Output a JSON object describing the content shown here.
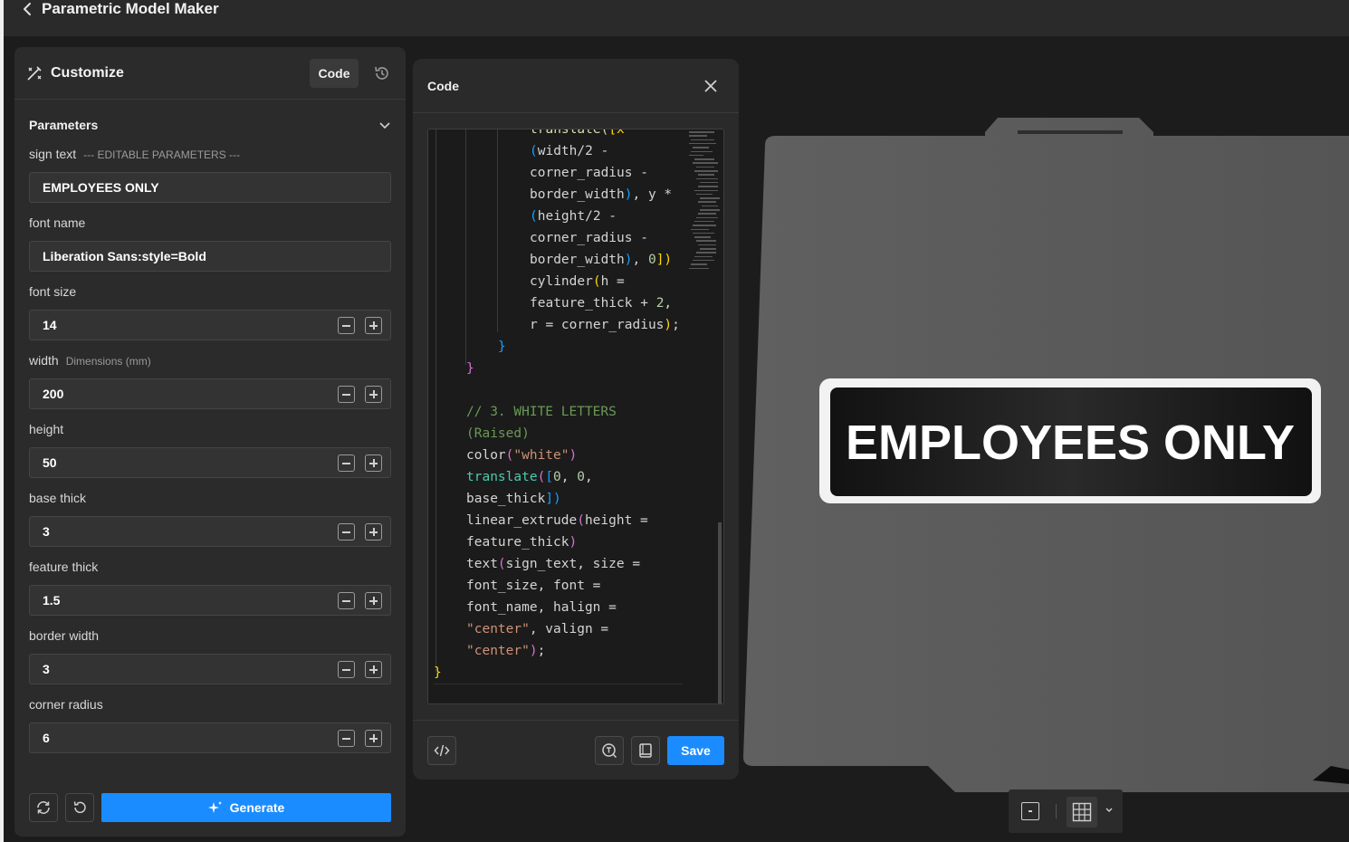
{
  "header": {
    "title": "Parametric Model Maker"
  },
  "customize": {
    "title": "Customize",
    "code_button": "Code",
    "parameters_title": "Parameters",
    "fields": [
      {
        "label": "sign text",
        "sublabel": "--- EDITABLE PARAMETERS ---",
        "value": "EMPLOYEES ONLY",
        "stepper": false
      },
      {
        "label": "font name",
        "sublabel": "",
        "value": "Liberation Sans:style=Bold",
        "stepper": false
      },
      {
        "label": "font size",
        "sublabel": "",
        "value": "14",
        "stepper": true
      },
      {
        "label": "width",
        "sublabel": "Dimensions (mm)",
        "value": "200",
        "stepper": true
      },
      {
        "label": "height",
        "sublabel": "",
        "value": "50",
        "stepper": true
      },
      {
        "label": "base thick",
        "sublabel": "",
        "value": "3",
        "stepper": true
      },
      {
        "label": "feature thick",
        "sublabel": "",
        "value": "1.5",
        "stepper": true
      },
      {
        "label": "border width",
        "sublabel": "",
        "value": "3",
        "stepper": true
      },
      {
        "label": "corner radius",
        "sublabel": "",
        "value": "6",
        "stepper": true
      }
    ],
    "generate_label": "Generate"
  },
  "code_panel": {
    "title": "Code",
    "save_label": "Save",
    "lines": [
      [
        {
          "t": "translate(",
          "c": "k-fn"
        },
        {
          "t": "[x *",
          "c": "k-paren3"
        }
      ],
      [
        {
          "t": "(",
          "c": "k-paren2"
        },
        {
          "t": "width/2 -",
          "c": "k-plain"
        }
      ],
      [
        {
          "t": "corner_radius -",
          "c": "k-plain"
        }
      ],
      [
        {
          "t": "border_width",
          "c": "k-plain"
        },
        {
          "t": ")",
          "c": "k-paren2"
        },
        {
          "t": ", y *",
          "c": "k-plain"
        }
      ],
      [
        {
          "t": "(",
          "c": "k-paren2"
        },
        {
          "t": "height/2 -",
          "c": "k-plain"
        }
      ],
      [
        {
          "t": "corner_radius -",
          "c": "k-plain"
        }
      ],
      [
        {
          "t": "border_width",
          "c": "k-plain"
        },
        {
          "t": ")",
          "c": "k-paren2"
        },
        {
          "t": ", ",
          "c": "k-plain"
        },
        {
          "t": "0",
          "c": "k-num"
        },
        {
          "t": "])",
          "c": "k-paren3"
        }
      ],
      [
        {
          "t": "cylinder",
          "c": "k-plain"
        },
        {
          "t": "(",
          "c": "k-paren3"
        },
        {
          "t": "h =",
          "c": "k-plain"
        }
      ],
      [
        {
          "t": "feature_thick + ",
          "c": "k-plain"
        },
        {
          "t": "2",
          "c": "k-num"
        },
        {
          "t": ",",
          "c": "k-plain"
        }
      ],
      [
        {
          "t": "r = corner_radius",
          "c": "k-plain"
        },
        {
          "t": ")",
          "c": "k-paren3"
        },
        {
          "t": ";",
          "c": "k-plain"
        }
      ],
      [
        {
          "t": "}",
          "c": "k-paren2"
        }
      ],
      [
        {
          "t": "}",
          "c": "k-paren1"
        }
      ],
      [
        {
          "t": "",
          "c": "k-plain"
        }
      ],
      [
        {
          "t": "// 3. WHITE LETTERS",
          "c": "k-comment"
        }
      ],
      [
        {
          "t": "(Raised)",
          "c": "k-comment"
        }
      ],
      [
        {
          "t": "color",
          "c": "k-plain"
        },
        {
          "t": "(",
          "c": "k-paren1"
        },
        {
          "t": "\"white\"",
          "c": "k-str"
        },
        {
          "t": ")",
          "c": "k-paren1"
        }
      ],
      [
        {
          "t": "translate",
          "c": "k-teal"
        },
        {
          "t": "(",
          "c": "k-paren1"
        },
        {
          "t": "[",
          "c": "k-paren2"
        },
        {
          "t": "0",
          "c": "k-num"
        },
        {
          "t": ", ",
          "c": "k-plain"
        },
        {
          "t": "0",
          "c": "k-num"
        },
        {
          "t": ",",
          "c": "k-plain"
        }
      ],
      [
        {
          "t": "base_thick",
          "c": "k-plain"
        },
        {
          "t": "])",
          "c": "k-paren2"
        }
      ],
      [
        {
          "t": "linear_extrude",
          "c": "k-plain"
        },
        {
          "t": "(",
          "c": "k-paren1"
        },
        {
          "t": "height =",
          "c": "k-plain"
        }
      ],
      [
        {
          "t": "feature_thick",
          "c": "k-plain"
        },
        {
          "t": ")",
          "c": "k-paren1"
        }
      ],
      [
        {
          "t": "text",
          "c": "k-plain"
        },
        {
          "t": "(",
          "c": "k-paren1"
        },
        {
          "t": "sign_text, size =",
          "c": "k-plain"
        }
      ],
      [
        {
          "t": "font_size, font =",
          "c": "k-plain"
        }
      ],
      [
        {
          "t": "font_name, halign =",
          "c": "k-plain"
        }
      ],
      [
        {
          "t": "\"center\"",
          "c": "k-str"
        },
        {
          "t": ", valign =",
          "c": "k-plain"
        }
      ],
      [
        {
          "t": "\"center\"",
          "c": "k-str"
        },
        {
          "t": ")",
          "c": "k-paren1"
        },
        {
          "t": ";",
          "c": "k-plain"
        }
      ],
      [
        {
          "t": "}",
          "c": "k-paren3"
        }
      ]
    ]
  },
  "preview": {
    "sign_text": "EMPLOYEES ONLY",
    "plate_color": "#5a5a5a",
    "sign_color": "#111111",
    "letter_color": "#ffffff"
  }
}
